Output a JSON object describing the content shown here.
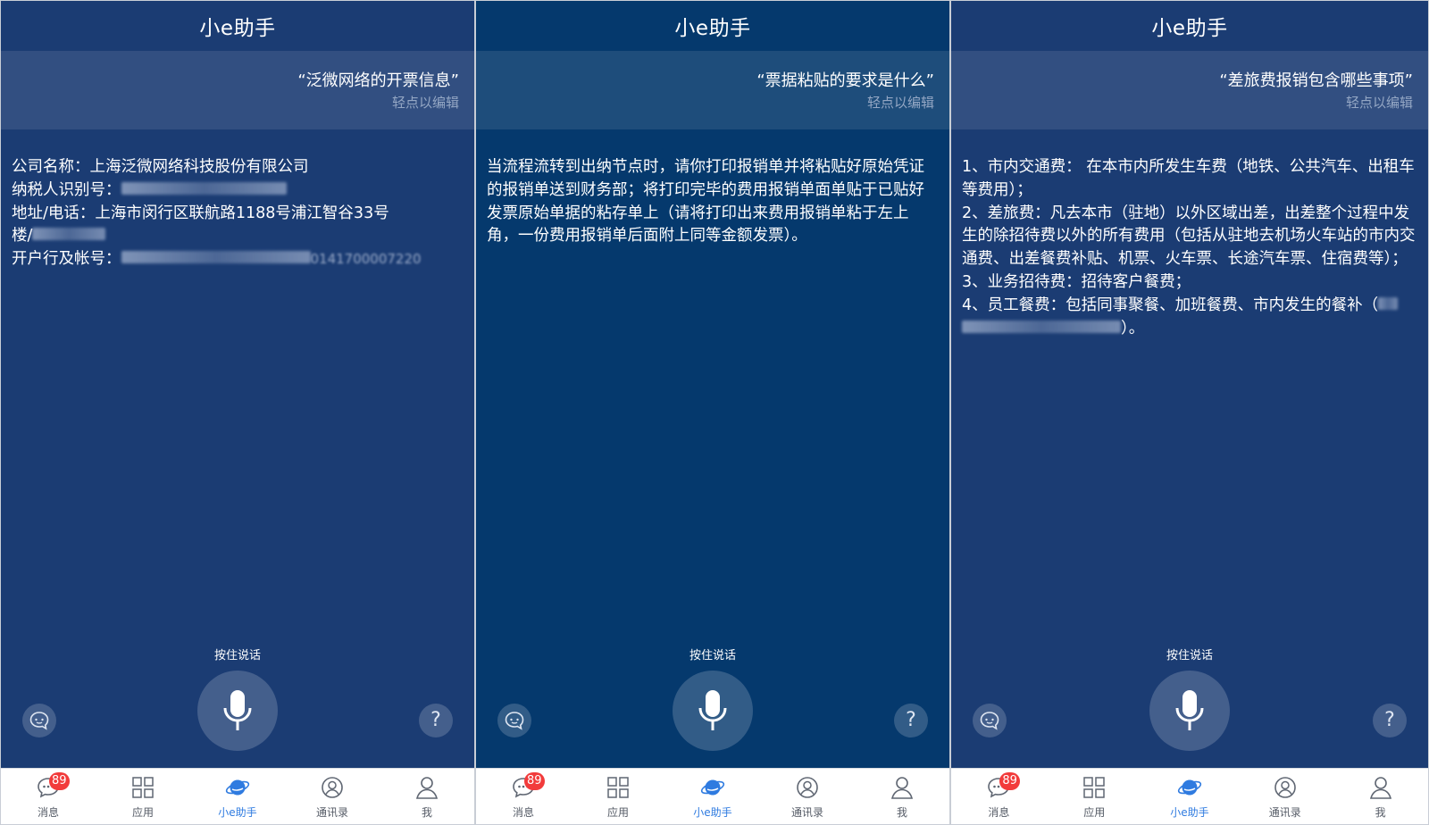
{
  "screens": [
    {
      "title": "小e助手",
      "query": "“泛微网络的开票信息”",
      "edit_hint": "轻点以编辑",
      "answer_lines": {
        "company": "公司名称：上海泛微网络科技股份有限公司",
        "tax_label": "纳税人识别号：",
        "address": "地址/电话：上海市闵行区联航路1188号浦江智谷33号",
        "floor_label": "楼/",
        "bank_label": "开户行及帐号：",
        "bank_tail": "0141700007220"
      }
    },
    {
      "title": "小e助手",
      "query": "“票据粘贴的要求是什么”",
      "edit_hint": "轻点以编辑",
      "answer": "当流程流转到出纳节点时，请你打印报销单并将粘贴好原始凭证的报销单送到财务部；将打印完毕的费用报销单面单贴于已贴好发票原始单据的粘存单上（请将打印出来费用报销单粘于左上角，一份费用报销单后面附上同等金额发票）。"
    },
    {
      "title": "小e助手",
      "query": "“差旅费报销包含哪些事项”",
      "edit_hint": "轻点以编辑",
      "answer_items": {
        "item1": "1、市内交通费： 在本市内所发生车费（地铁、公共汽车、出租车等费用）；",
        "item2": "2、差旅费：凡去本市（驻地）以外区域出差，出差整个过程中发生的除招待费以外的所有费用（包括从驻地去机场火车站的市内交通费、出差餐费补贴、机票、火车票、长途汽车票、住宿费等）；",
        "item3": "3、业务招待费：招待客户餐费；",
        "item4": "4、员工餐费：包括同事聚餐、加班餐费、市内发生的餐补（",
        "item4_tail": "）。"
      }
    }
  ],
  "voice": {
    "hold_to_talk": "按住说话"
  },
  "help_glyph": "?",
  "tabbar": {
    "messages": "消息",
    "messages_badge": "89",
    "apps": "应用",
    "assistant": "小e助手",
    "contacts": "通讯录",
    "me": "我"
  },
  "colors": {
    "bg_dark": "#1b3c73",
    "bg_light": "#05396d",
    "accent": "#2f7be0",
    "badge": "#f23b3b"
  }
}
